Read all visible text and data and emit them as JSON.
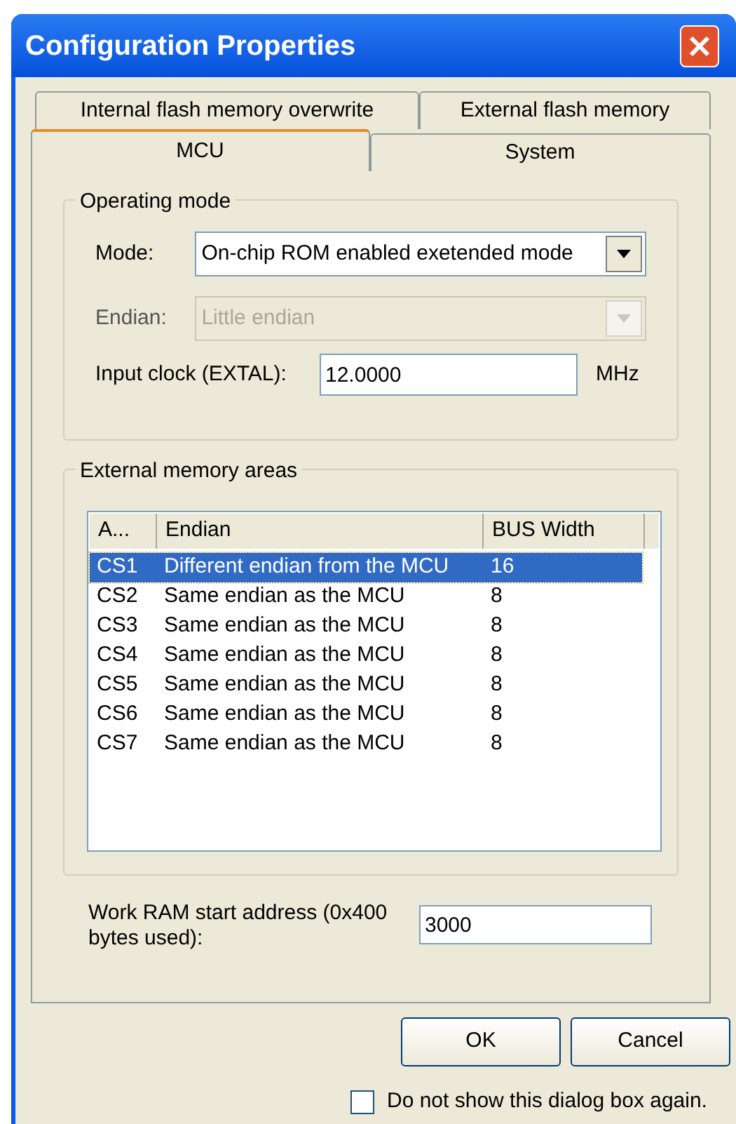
{
  "window": {
    "title": "Configuration Properties"
  },
  "tab_rows": [
    [
      {
        "label": "Internal flash memory overwrite",
        "selected": false
      },
      {
        "label": "External flash memory",
        "selected": false
      }
    ],
    [
      {
        "label": "MCU",
        "selected": true
      },
      {
        "label": "System",
        "selected": false
      }
    ]
  ],
  "operating_mode": {
    "title": "Operating mode",
    "mode": {
      "label": "Mode:",
      "value": "On-chip ROM enabled exetended mode",
      "disabled": false
    },
    "endian": {
      "label": "Endian:",
      "value": "Little endian",
      "disabled": true
    },
    "input_clock": {
      "label": "Input clock (EXTAL):",
      "value": "12.0000",
      "unit": "MHz"
    }
  },
  "external_memory": {
    "title": "External memory areas",
    "columns": [
      "A...",
      "Endian",
      "BUS Width"
    ],
    "rows": [
      {
        "cells": [
          "CS1",
          "Different endian from the MCU",
          "16"
        ],
        "selected": true
      },
      {
        "cells": [
          "CS2",
          "Same endian as the MCU",
          "8"
        ],
        "selected": false
      },
      {
        "cells": [
          "CS3",
          "Same endian as the MCU",
          "8"
        ],
        "selected": false
      },
      {
        "cells": [
          "CS4",
          "Same endian as the MCU",
          "8"
        ],
        "selected": false
      },
      {
        "cells": [
          "CS5",
          "Same endian as the MCU",
          "8"
        ],
        "selected": false
      },
      {
        "cells": [
          "CS6",
          "Same endian as the MCU",
          "8"
        ],
        "selected": false
      },
      {
        "cells": [
          "CS7",
          "Same endian as the MCU",
          "8"
        ],
        "selected": false
      }
    ]
  },
  "work_ram": {
    "label": "Work RAM start address (0x400 bytes used):",
    "value": "3000"
  },
  "buttons": [
    "OK",
    "Cancel"
  ],
  "dont_show": {
    "label": "Do not show this dialog box again.",
    "checked": false
  }
}
